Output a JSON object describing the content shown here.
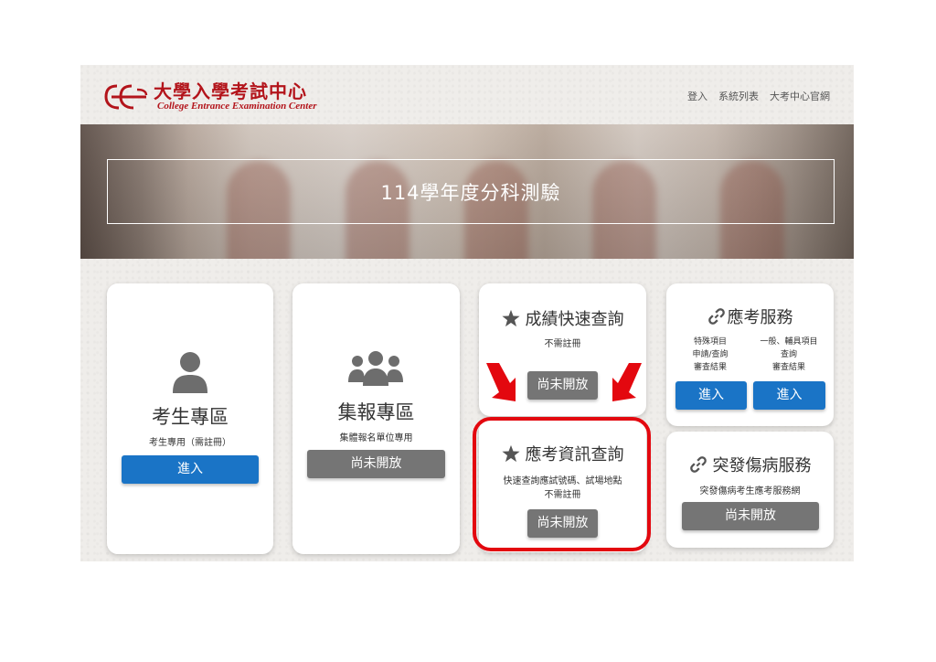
{
  "header": {
    "logo_zh": "大學入學考試中心",
    "logo_en": "College Entrance Examination Center",
    "nav": [
      "登入",
      "系統列表",
      "大考中心官網"
    ]
  },
  "banner": {
    "title": "114學年度分科測驗"
  },
  "cards": {
    "candidate": {
      "icon": "user-icon",
      "title": "考生專區",
      "note": "考生專用（需註冊）",
      "button": "進入"
    },
    "group": {
      "icon": "users-group-icon",
      "title": "集報專區",
      "note": "集體報名單位專用",
      "button": "尚未開放"
    },
    "score": {
      "icon": "star-icon",
      "title": "成績快速查詢",
      "note": "不需註冊",
      "button": "尚未開放"
    },
    "exam_info": {
      "icon": "star-icon",
      "title": "應考資訊查詢",
      "note_line1": "快速查詢應試號碼、試場地點",
      "note_line2": "不需註冊",
      "button": "尚未開放"
    },
    "service": {
      "icon": "link-icon",
      "title": "應考服務",
      "col1": [
        "特殊項目",
        "申請/查詢",
        "審查結果"
      ],
      "col2": [
        "一般、輔具項目",
        "查詢",
        "審查結果"
      ],
      "button1": "進入",
      "button2": "進入"
    },
    "emergency": {
      "icon": "link-icon",
      "title": "突發傷病服務",
      "note": "突發傷病考生應考服務網",
      "button": "尚未開放"
    }
  },
  "annotation_color": "#e3080f"
}
